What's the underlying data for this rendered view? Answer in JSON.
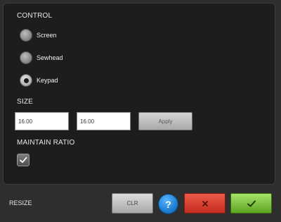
{
  "sections": {
    "control": "CONTROL",
    "size": "SIZE",
    "maintain_ratio": "MAINTAIN RATIO"
  },
  "control_options": [
    {
      "label": "Screen",
      "selected": false
    },
    {
      "label": "Sewhead",
      "selected": false
    },
    {
      "label": "Keypad",
      "selected": true
    }
  ],
  "size": {
    "width_value": "16.00",
    "height_value": "16.00",
    "apply_label": "Apply"
  },
  "maintain_ratio_checked": true,
  "footer": {
    "title": "RESIZE",
    "clr_label": "CLR",
    "help_glyph": "?",
    "cancel_icon": "x-icon",
    "ok_icon": "check-icon"
  },
  "colors": {
    "cancel": "#d63b2c",
    "ok": "#7ac13f",
    "help": "#1e7fd2"
  }
}
